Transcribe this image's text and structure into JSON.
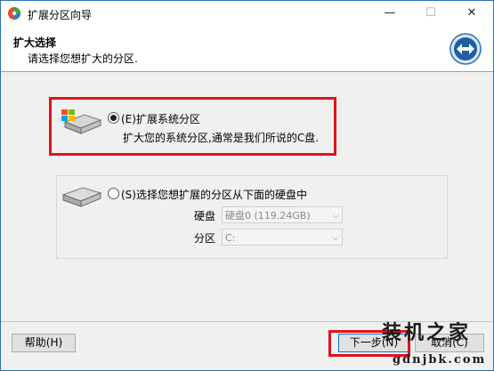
{
  "window": {
    "title": "扩展分区向导",
    "minimize_glyph": "—",
    "maximize_glyph": "☐",
    "close_glyph": "✕"
  },
  "header": {
    "title": "扩大选择",
    "subtitle": "请选择您想扩大的分区."
  },
  "options": [
    {
      "label": "(E)扩展系统分区",
      "description": "扩大您的系统分区,通常是我们所说的C盘.",
      "selected": true
    },
    {
      "label": "(S)选择您想扩展的分区从下面的硬盘中",
      "selected": false,
      "disk_label": "硬盘",
      "disk_value": "硬盘0 (119.24GB)",
      "partition_label": "分区",
      "partition_value": "C:"
    }
  ],
  "buttons": {
    "help": "帮助(H)",
    "next": "下一步(N)",
    "cancel": "取消(C)"
  },
  "watermark": {
    "brand": "装机之家",
    "url": "gdnjbk.com"
  },
  "colors": {
    "highlight_box": "#e2121b",
    "window_border": "#2b6fb5"
  }
}
